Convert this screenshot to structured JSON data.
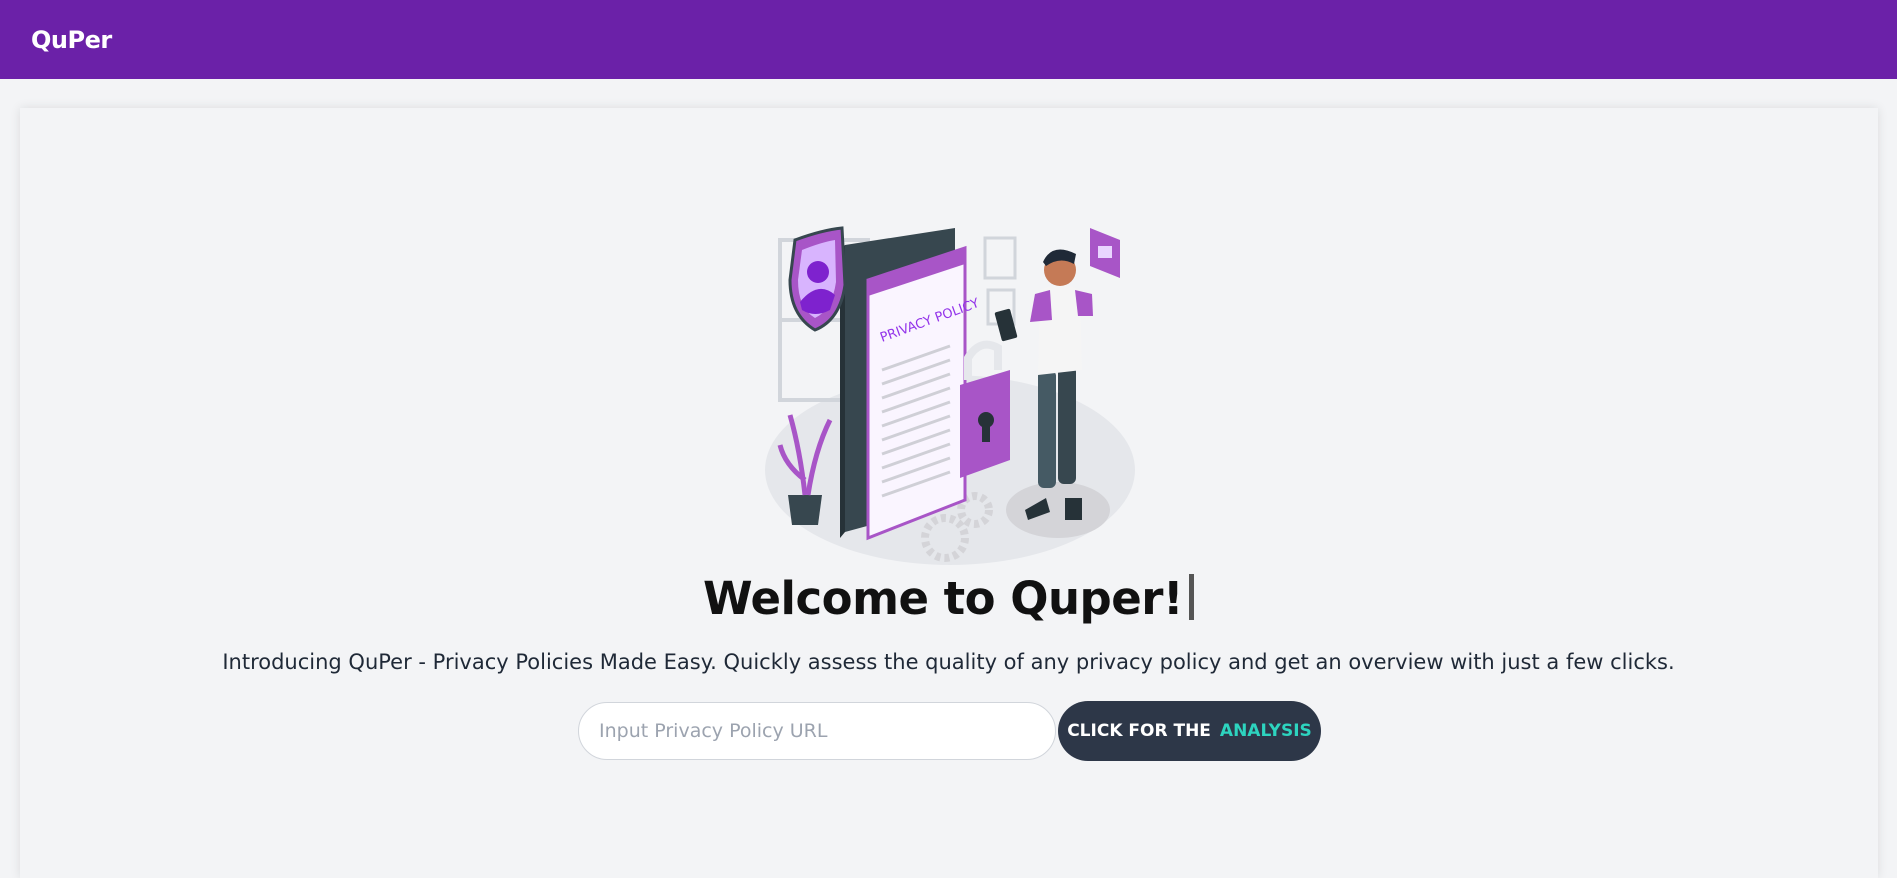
{
  "navbar": {
    "brand": "QuPer"
  },
  "hero": {
    "illustration": {
      "document_label": "PRIVACY POLICY",
      "icons": [
        "shield-user-icon",
        "padlock-icon",
        "phone-icon",
        "person-figure",
        "plant-icon",
        "gear-icon",
        "lock-badge-icon"
      ]
    },
    "title": "Welcome to Quper!",
    "subtitle": "Introducing QuPer - Privacy Policies Made Easy. Quickly assess the quality of any privacy policy and get an overview with just a few clicks."
  },
  "search": {
    "url_value": "",
    "url_placeholder": "Input Privacy Policy URL",
    "button_label": "CLICK FOR THE",
    "button_accent": "ANALYSIS"
  },
  "colors": {
    "navbar": "#6b21a8",
    "button": "#2d3748",
    "button_accent": "#2dd4bf",
    "illustration_purple": "#a855c7"
  }
}
